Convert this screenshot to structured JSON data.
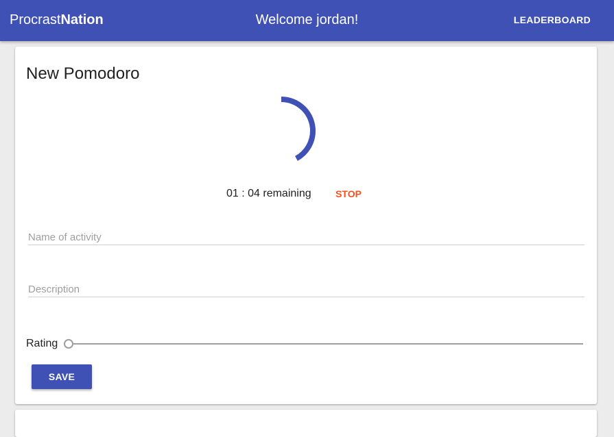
{
  "appbar": {
    "brand_regular": "Procrast",
    "brand_bold": "Nation",
    "welcome": "Welcome jordan!",
    "leaderboard_label": "LEADERBOARD"
  },
  "pomodoro": {
    "title": "New Pomodoro",
    "progress_fraction": 0.42,
    "remaining_text": "01 : 04 remaining",
    "stop_label": "STOP",
    "name_placeholder": "Name of activity",
    "name_value": "",
    "description_placeholder": "Description",
    "description_value": "",
    "rating_label": "Rating",
    "rating_value": 0,
    "save_label": "SAVE"
  },
  "colors": {
    "primary": "#3f51b5",
    "accent": "#f4511e"
  }
}
